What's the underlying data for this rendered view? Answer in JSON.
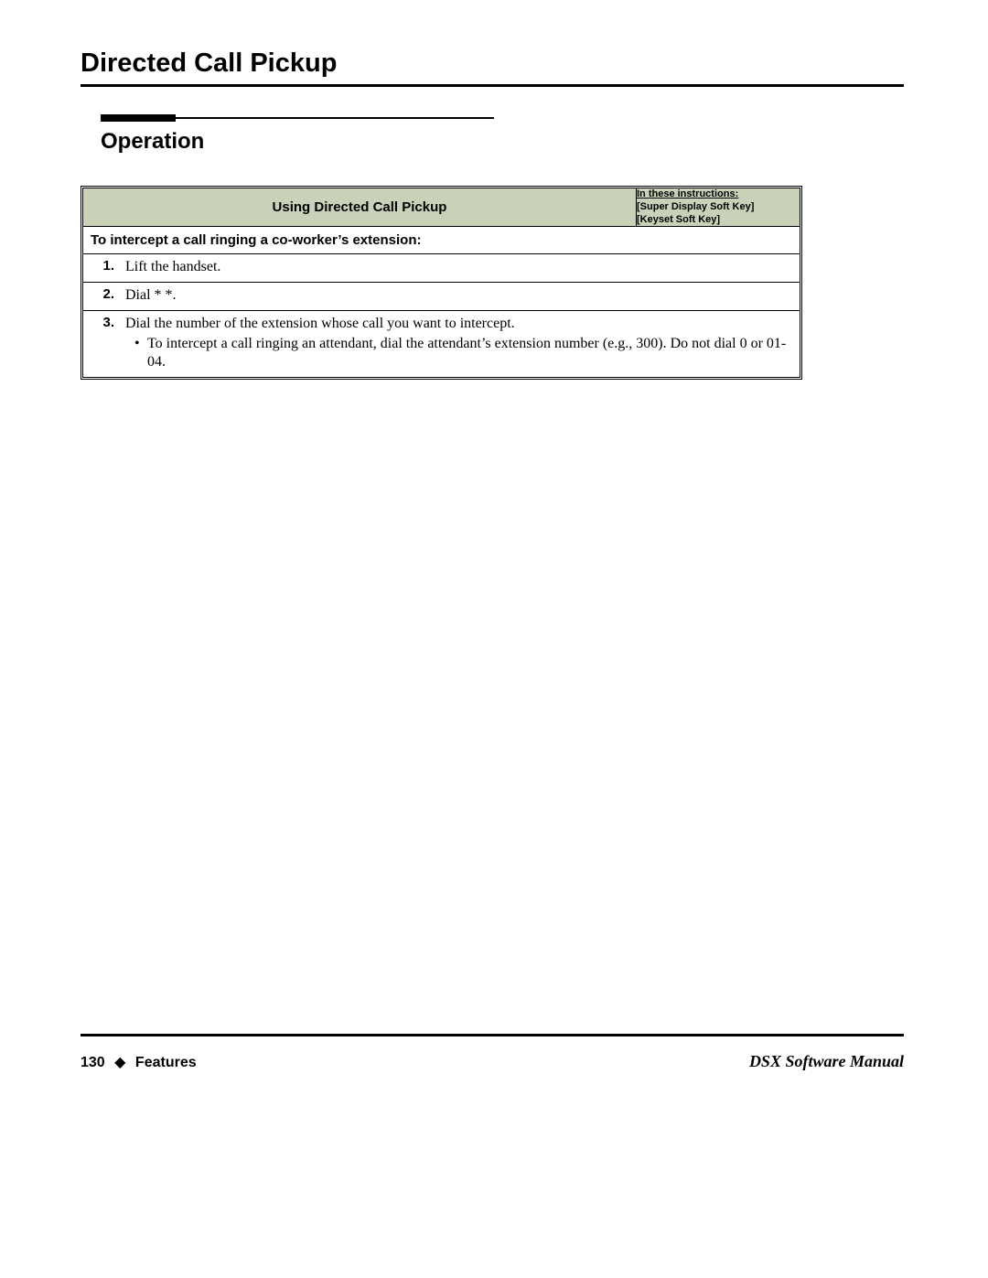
{
  "page_title": "Directed Call Pickup",
  "section_title": "Operation",
  "table": {
    "header_main": "Using Directed Call Pickup",
    "header_side_underline": "In these instructions:",
    "header_side_line2": "[Super Display Soft Key]",
    "header_side_line3": "[Keyset Soft Key]",
    "subheader": "To intercept a call ringing a co-worker’s extension:",
    "steps": [
      {
        "num": "1.",
        "text": "Lift the handset."
      },
      {
        "num": "2.",
        "text": "Dial * *."
      },
      {
        "num": "3.",
        "text": "Dial the number of the extension whose call you want to intercept.",
        "bullet": "To intercept a call ringing an attendant, dial the attendant’s extension number (e.g., 300). Do not dial 0 or 01-04."
      }
    ]
  },
  "footer": {
    "page_number": "130",
    "diamond": "◆",
    "section": "Features",
    "manual": "DSX Software Manual"
  }
}
